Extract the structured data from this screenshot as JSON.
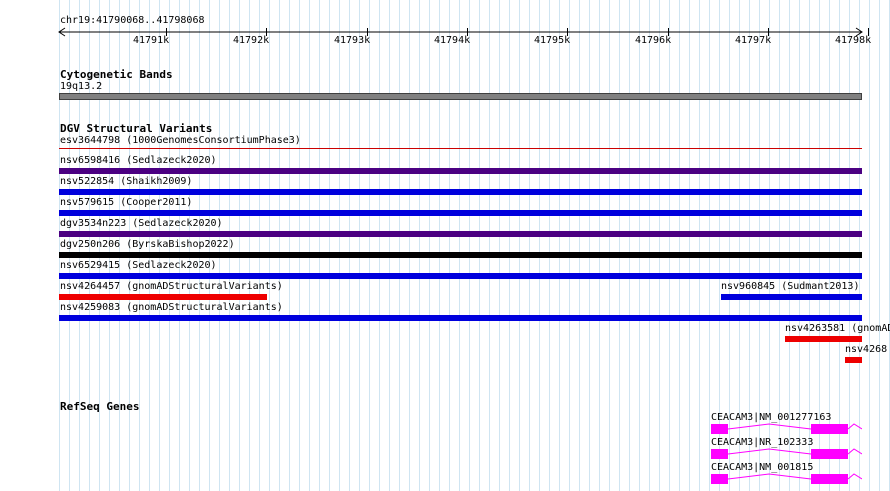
{
  "ruler": {
    "location": "chr19:41790068..41798068",
    "ticks": [
      "41791k",
      "41792k",
      "41793k",
      "41794k",
      "41795k",
      "41796k",
      "41797k",
      "41798k"
    ]
  },
  "cytoband": {
    "title": "Cytogenetic Bands",
    "band_label": "19q13.2"
  },
  "dgv": {
    "title": "DGV Structural Variants",
    "features": [
      {
        "label": "esv3644798 (1000GenomesConsortiumPhase3)",
        "color": "#cc0000"
      },
      {
        "label": "nsv6598416 (Sedlazeck2020)",
        "color": "#4b0082"
      },
      {
        "label": "nsv522854 (Shaikh2009)",
        "color": "#0000dd"
      },
      {
        "label": "nsv579615 (Cooper2011)",
        "color": "#0000dd"
      },
      {
        "label": "dgv3534n223 (Sedlazeck2020)",
        "color": "#4b0082"
      },
      {
        "label": "dgv250n206 (ByrskaBishop2022)",
        "color": "#000000"
      },
      {
        "label": "nsv6529415 (Sedlazeck2020)",
        "color": "#0000dd"
      },
      {
        "label": "nsv4264457 (gnomADStructuralVariants)",
        "color": "#ee0000"
      },
      {
        "label": "nsv960845 (Sudmant2013)",
        "color": "#0000dd"
      },
      {
        "label": "nsv4259083 (gnomADStructuralVariants)",
        "color": "#0000dd"
      },
      {
        "label": "nsv4263581 (gnomAD",
        "color": "#ee0000"
      },
      {
        "label": "nsv4268",
        "color": "#ee0000"
      }
    ]
  },
  "refseq": {
    "title": "RefSeq Genes",
    "genes": [
      {
        "label": "CEACAM3|NM_001277163",
        "color": "#ff00ff"
      },
      {
        "label": "CEACAM3|NR_102333",
        "color": "#ff00ff"
      },
      {
        "label": "CEACAM3|NM_001815",
        "color": "#ff00ff"
      }
    ]
  }
}
